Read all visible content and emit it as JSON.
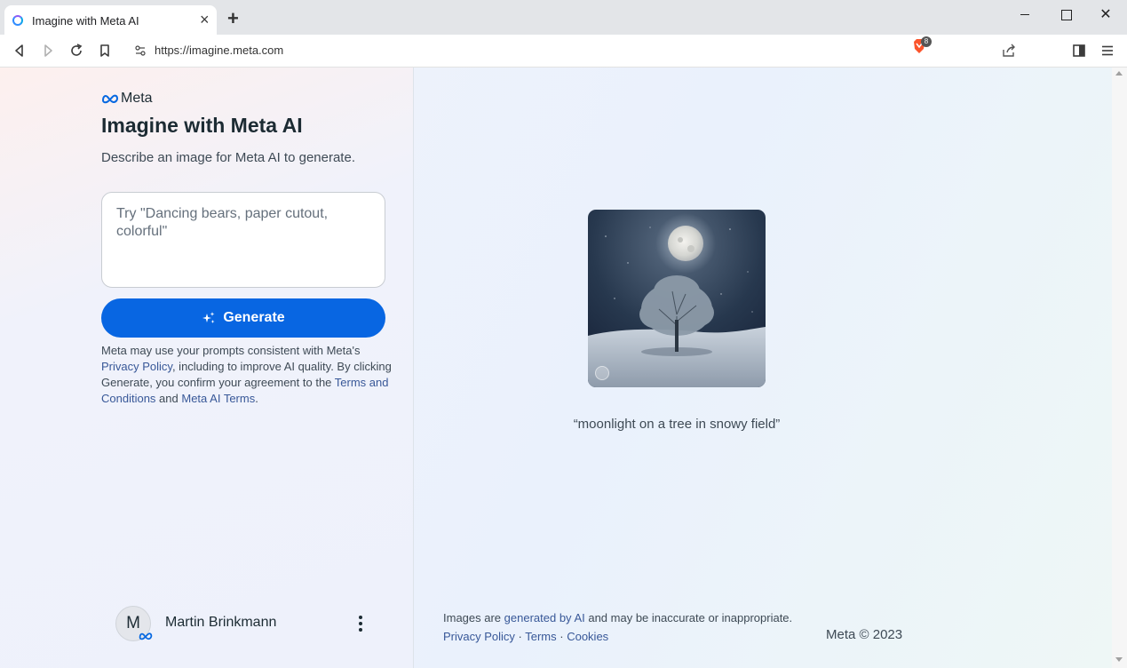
{
  "browser": {
    "tab_title": "Imagine with Meta AI",
    "url": "https://imagine.meta.com",
    "shields_badge": "8",
    "icons": [
      "back-icon",
      "forward-icon",
      "reload-icon",
      "bookmark-icon",
      "site-info-icon",
      "share-icon",
      "brave-shields-icon",
      "sidebar-icon",
      "menu-icon"
    ]
  },
  "left": {
    "logo_text": "Meta",
    "title": "Imagine with Meta AI",
    "subtitle": "Describe an image for Meta AI to generate.",
    "prompt_placeholder": "Try \"Dancing bears, paper cutout, colorful\"",
    "prompt_value": "",
    "generate_label": "Generate",
    "disclaimer": {
      "p1": "Meta may use your prompts consistent with Meta's ",
      "privacy_link": "Privacy Policy",
      "p2": ", including to improve AI quality. By clicking Generate, you confirm your agreement to the ",
      "terms_link": "Terms and Conditions",
      "p3": " and ",
      "ai_terms_link": "Meta AI Terms",
      "p4": "."
    },
    "user": {
      "initial": "M",
      "name": "Martin Brinkmann"
    }
  },
  "main": {
    "image_alt_caption": "“moonlight on a tree in snowy field”"
  },
  "footer": {
    "note_p1": "Images are ",
    "note_link": "generated by AI",
    "note_p2": " and may be inaccurate or inappropriate.",
    "privacy": "Privacy Policy",
    "terms": "Terms",
    "cookies": "Cookies",
    "sep": " · ",
    "copyright": "Meta © 2023"
  },
  "colors": {
    "accent": "#0866e2",
    "link": "#385898",
    "text": "#1c2b33"
  }
}
